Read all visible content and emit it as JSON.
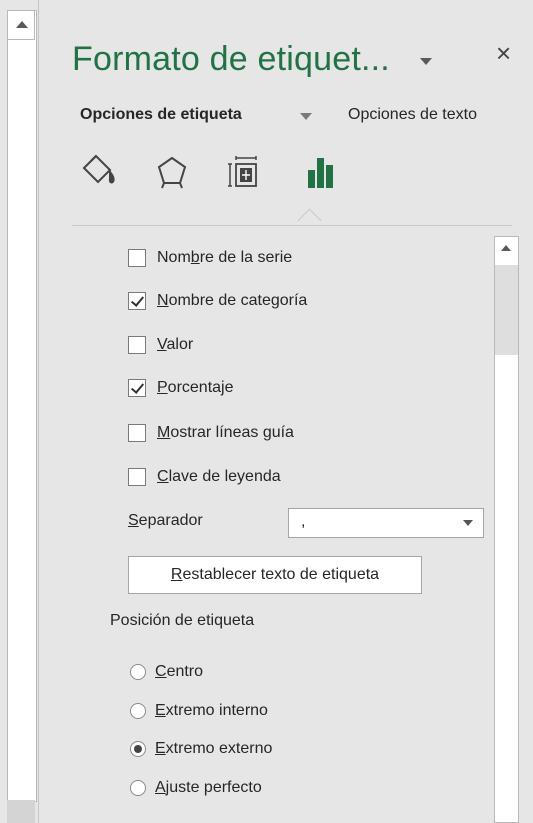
{
  "pane": {
    "title": "Formato de etiquet...",
    "close_label": "×"
  },
  "tabs": {
    "label_options": "Opciones de etiqueta",
    "text_options": "Opciones de texto"
  },
  "icons": [
    "fill-line-icon",
    "effects-icon",
    "size-properties-icon",
    "label-options-icon"
  ],
  "colors": {
    "accent": "#217346",
    "panel_bg": "#e6e6e6"
  },
  "options": [
    {
      "pre": "Nom",
      "u": "b",
      "post": "re de la serie",
      "checked": false
    },
    {
      "pre": "",
      "u": "N",
      "post": "ombre de categoría",
      "checked": true
    },
    {
      "pre": "",
      "u": "V",
      "post": "alor",
      "checked": false
    },
    {
      "pre": "",
      "u": "P",
      "post": "orcentaje",
      "checked": true
    },
    {
      "pre": "",
      "u": "M",
      "post": "ostrar líneas guía",
      "checked": false
    },
    {
      "pre": "",
      "u": "C",
      "post": "lave de leyenda",
      "checked": false
    }
  ],
  "separator": {
    "label_u": "S",
    "label_rest": "eparador",
    "value": ","
  },
  "reset_button": {
    "u": "R",
    "rest": "establecer texto de etiqueta"
  },
  "position": {
    "heading": "Posición de etiqueta",
    "items": [
      {
        "u": "C",
        "rest": "entro",
        "selected": false
      },
      {
        "u": "E",
        "rest": "xtremo interno",
        "selected": false
      },
      {
        "u": "E",
        "rest": "xtremo externo",
        "selected": true
      },
      {
        "u": "A",
        "rest": "juste perfecto",
        "selected": false
      }
    ]
  }
}
